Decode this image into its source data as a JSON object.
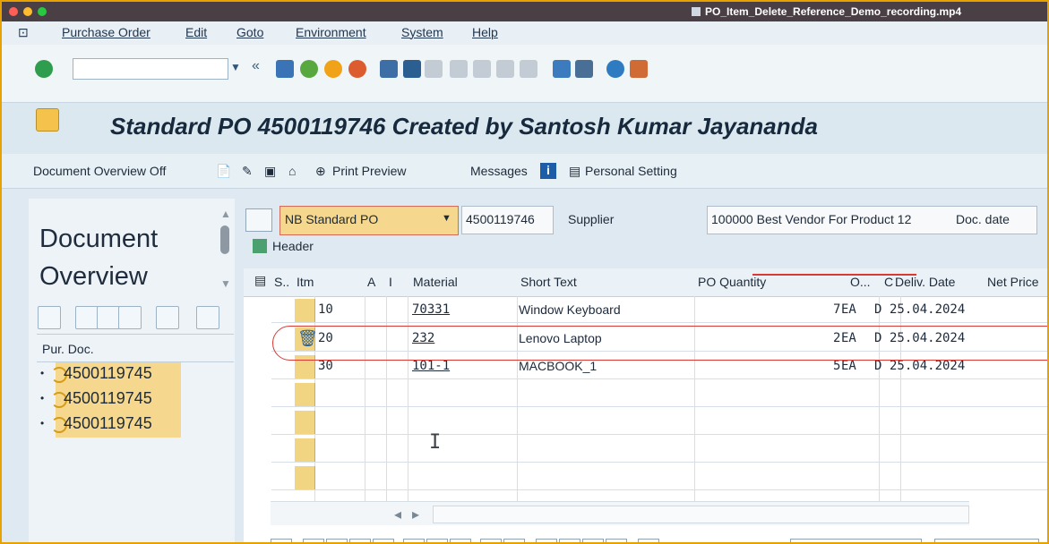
{
  "window": {
    "title": "PO_Item_Delete_Reference_Demo_recording.mp4"
  },
  "menu": [
    "Purchase Order",
    "Edit",
    "Goto",
    "Environment",
    "System",
    "Help"
  ],
  "header": {
    "title": "Standard PO 4500119746 Created by Santosh Kumar Jayananda"
  },
  "appbar": {
    "document_overview": "Document Overview Off",
    "print_preview": "Print Preview",
    "messages": "Messages",
    "personal_setting": "Personal Setting"
  },
  "left": {
    "title_line1": "Document",
    "title_line2": "Overview",
    "purdoc_label": "Pur. Doc.",
    "items": [
      "4500119745",
      "4500119745",
      "4500119745"
    ]
  },
  "po": {
    "order_type": "NB Standard PO",
    "number": "4500119746",
    "supplier_label": "Supplier",
    "supplier_value": "100000 Best Vendor For Product 12",
    "doc_date_label": "Doc. date",
    "header_label": "Header"
  },
  "table": {
    "columns": [
      "S..",
      "Itm",
      "A",
      "I",
      "Material",
      "Short Text",
      "PO Quantity",
      "O...",
      "C",
      "Deliv. Date",
      "Net Price"
    ],
    "rows": [
      {
        "item": "10",
        "material": "70331",
        "short_text": "Window Keyboard",
        "qty": "7",
        "unit": "EA",
        "c": "D",
        "date": "25.04.2024"
      },
      {
        "item": "20",
        "material": "232",
        "short_text": "Lenovo Laptop",
        "qty": "2",
        "unit": "EA",
        "c": "D",
        "date": "25.04.2024"
      },
      {
        "item": "30",
        "material": "101-1",
        "short_text": "MACBOOK_1",
        "qty": "5",
        "unit": "EA",
        "c": "D",
        "date": "25.04.2024"
      }
    ]
  },
  "colors": {
    "accent": "#e8a200",
    "selection": "#f5d88d",
    "annotation": "#d93b34"
  }
}
